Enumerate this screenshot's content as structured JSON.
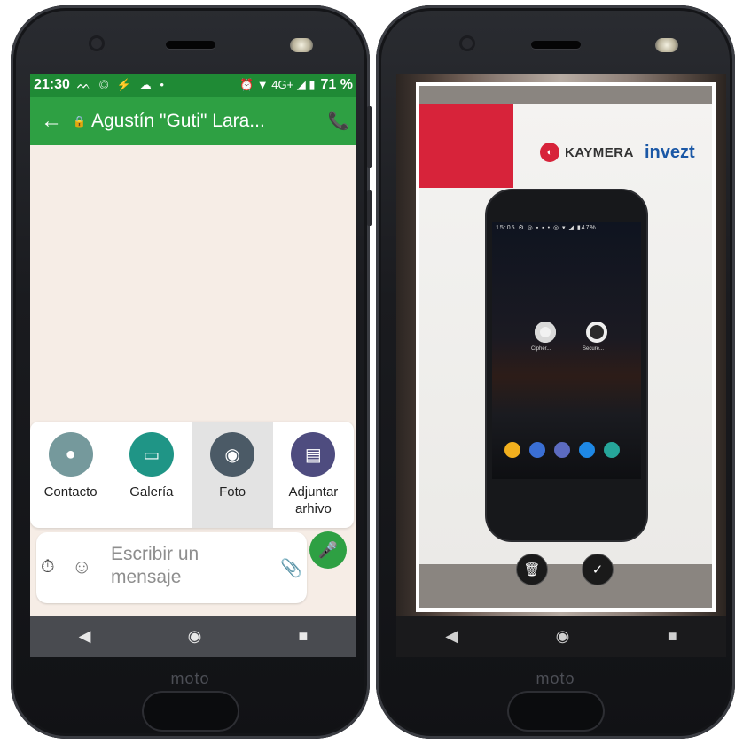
{
  "left_phone": {
    "status_bar": {
      "time": "21:30",
      "left_icons": "ᨓ ◎ ⚡ ☁ •",
      "right_icons": "⏰ ▼ 4G+ ◢ ▮",
      "battery": "71 %"
    },
    "app_bar": {
      "back": "←",
      "lock": "🔒",
      "contact_name": "Agustín \"Guti\" Lara...",
      "call": "📞"
    },
    "attach_menu": [
      {
        "label": "Contacto",
        "icon": "person-icon",
        "glyph": "●",
        "color": "#75999c"
      },
      {
        "label": "Galería",
        "icon": "image-icon",
        "glyph": "▭",
        "color": "#1f9586"
      },
      {
        "label": "Foto",
        "icon": "camera-shutter-icon",
        "glyph": "◉",
        "color": "#4b5a66",
        "selected": true
      },
      {
        "label": "Adjuntar\narhivo",
        "icon": "document-icon",
        "glyph": "▤",
        "color": "#4e4c7f"
      }
    ],
    "compose": {
      "timer": "⏱",
      "emoji": "☺",
      "placeholder": "Escribir un mensaje",
      "clip": "📎",
      "mic": "🎤"
    },
    "nav": {
      "back": "◀",
      "home": "◉",
      "recents": "■"
    },
    "brand": "moto"
  },
  "right_phone": {
    "photo": {
      "brand_kaymera": "KAYMERA",
      "brand_invezt": "invezt",
      "logo_glyph": "◐",
      "mini_status": "15:05 ⚙ ◎ ▪ ▪ •    ◎ ▾  ◢ ▮47%",
      "mini_apps": [
        {
          "label": "Cipher..."
        },
        {
          "label": "Secure..."
        }
      ]
    },
    "controls": {
      "delete": "🗑",
      "confirm": "✓"
    },
    "nav": {
      "back": "◀",
      "home": "◉",
      "recents": "■"
    },
    "brand": "moto"
  }
}
